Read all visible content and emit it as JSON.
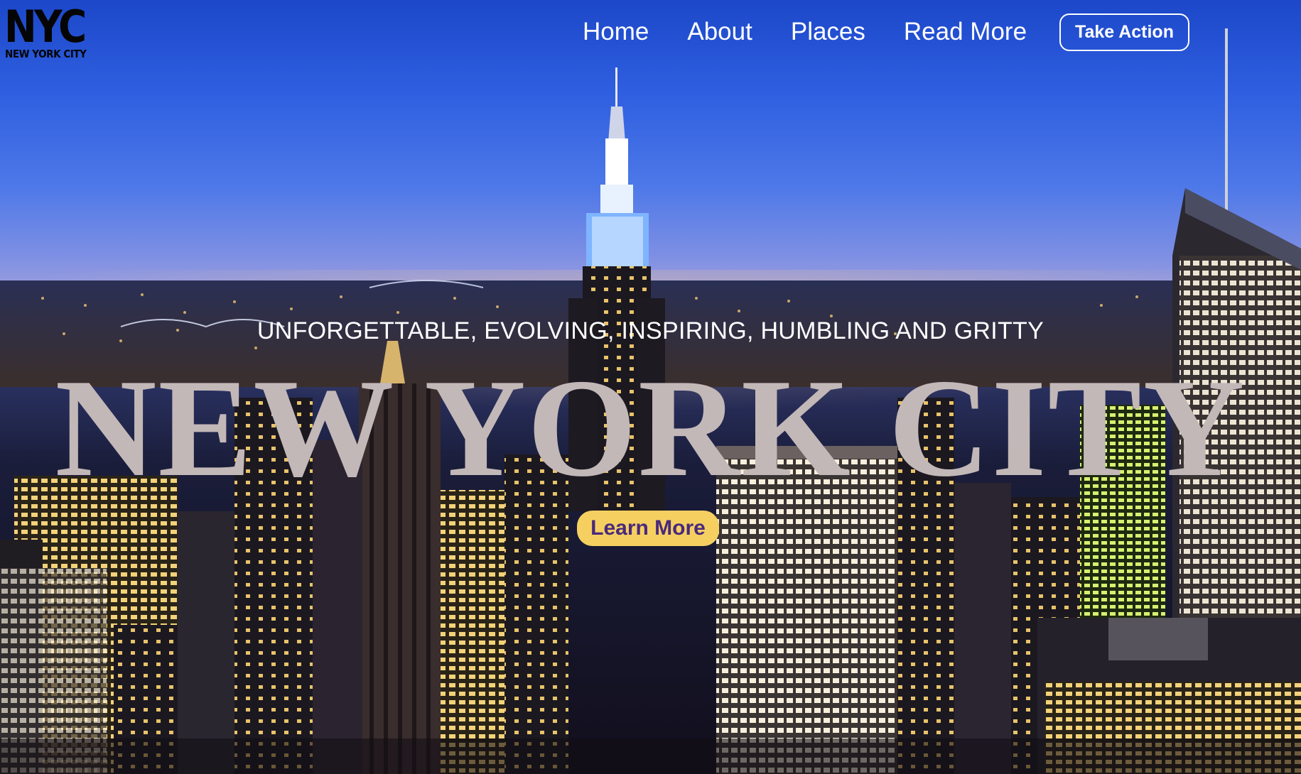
{
  "brand": {
    "logo_text": "NYC",
    "logo_subtext": "NEW YORK CITY"
  },
  "nav": {
    "items": [
      {
        "label": "Home"
      },
      {
        "label": "About"
      },
      {
        "label": "Places"
      },
      {
        "label": "Read More"
      }
    ],
    "cta_label": "Take Action"
  },
  "hero": {
    "tagline": "UNFORGETTABLE, EVOLVING, INSPIRING, HUMBLING AND GRITTY",
    "title": "NEW YORK CITY",
    "button_label": "Learn More"
  },
  "colors": {
    "title_text": "#c3b8b8",
    "button_bg": "#f5d061",
    "button_text": "#4a2a7a",
    "sky_top": "#1c47c9"
  }
}
